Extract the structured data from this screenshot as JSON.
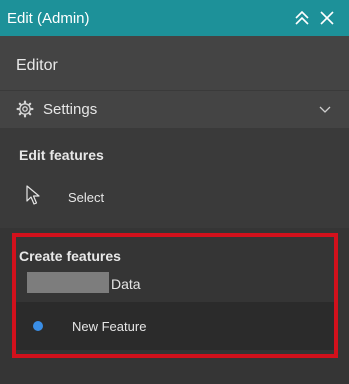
{
  "window": {
    "title": "Edit (Admin)",
    "collapse_icon": "double-chevron-up-icon",
    "close_icon": "close-icon"
  },
  "editor": {
    "title": "Editor",
    "settings_label": "Settings",
    "settings_icon": "gear-icon",
    "settings_chevron_icon": "chevron-down-icon"
  },
  "edit_features": {
    "heading": "Edit features",
    "select_label": "Select",
    "select_icon": "cursor-arrow-icon"
  },
  "create_features": {
    "heading": "Create features",
    "layer_label": "Data",
    "feature_label": "New Feature",
    "feature_symbol_color": "#3a8ee6",
    "highlight_color": "#d2111c"
  },
  "colors": {
    "titlebar": "#1d9199",
    "background": "#3a3a3a"
  }
}
